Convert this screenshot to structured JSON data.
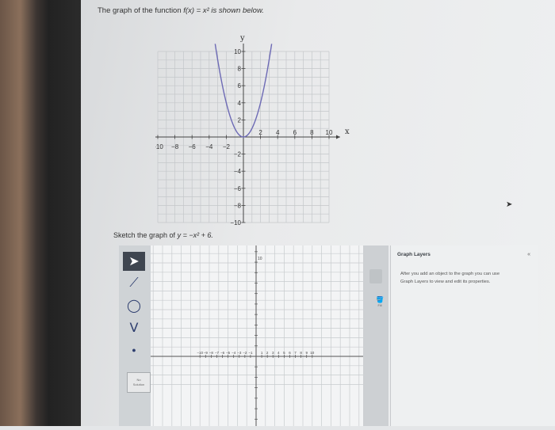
{
  "problem": {
    "prompt_prefix": "The graph of the function ",
    "prompt_function": "f(x) = x² is shown below.",
    "sketch_prefix": "Sketch the graph of ",
    "sketch_equation": "y = −x² + 6."
  },
  "example_graph": {
    "x_axis_label": "x",
    "y_axis_label": "y",
    "x_ticks": [
      "−10",
      "−8",
      "−6",
      "−4",
      "−2",
      "2",
      "4",
      "6",
      "8",
      "10"
    ],
    "y_ticks": [
      "10",
      "8",
      "6",
      "4",
      "2",
      "−2",
      "−4",
      "−6",
      "−8",
      "−10"
    ],
    "curve_color": "#6d6ab5"
  },
  "work_graph": {
    "x_ticks": [
      "−10",
      "−9",
      "−8",
      "−7",
      "−6",
      "−5",
      "−4",
      "−3",
      "−2",
      "−1",
      "1",
      "2",
      "3",
      "4",
      "5",
      "6",
      "7",
      "8",
      "9",
      "10"
    ],
    "y_top_label": "10"
  },
  "toolbox": {
    "no_solution_line1": "No",
    "no_solution_line2": "Solution",
    "tools": [
      "pointer-icon",
      "line-segment-icon",
      "circle-icon",
      "parabola-icon",
      "point-icon"
    ]
  },
  "fill_tool_label": "Fill",
  "layers_panel": {
    "title": "Graph Layers",
    "collapse": "«",
    "help_text": "After you add an object to the graph you can use Graph Layers to view and edit its properties."
  }
}
